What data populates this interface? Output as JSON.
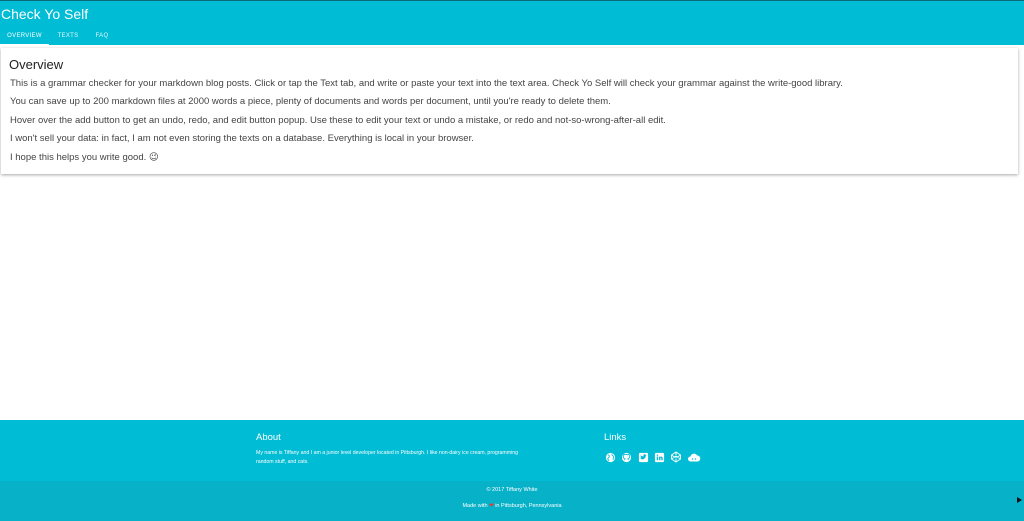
{
  "header": {
    "title": "Check Yo Self",
    "tabs": [
      {
        "label": "Overview"
      },
      {
        "label": "Texts"
      },
      {
        "label": "FAQ"
      }
    ]
  },
  "overview": {
    "title": "Overview",
    "paragraphs": [
      "This is a grammar checker for your markdown blog posts. Click or tap the Text tab, and write or paste your text into the text area. Check Yo Self will check your grammar against the write-good library.",
      "You can save up to 200 markdown files at 2000 words a piece, plenty of documents and words per document, until you're ready to delete them.",
      "Hover over the add button to get an undo, redo, and edit button popup. Use these to edit your text or undo a mistake, or redo and not-so-wrong-after-all edit.",
      "I won't sell your data: in fact, I am not even storing the texts on a database. Everything is local in your browser.",
      "I hope this helps you write good. 😉"
    ]
  },
  "footer": {
    "about_title": "About",
    "about_text": "My name is Tiffany and I am a junior level developer located in Pittsburgh. I like non-dairy ice cream, programming random stuff, and cats.",
    "links_title": "Links",
    "link_icons": [
      "globe-icon",
      "github-icon",
      "twitter-icon",
      "linkedin-icon",
      "codepen-icon",
      "cloud-icon"
    ],
    "copyright": "© 2017 Tiffany White",
    "made_with_prefix": "Made with",
    "heart": "❤",
    "made_with_suffix": "in Pittsburgh, Pennsylvania"
  },
  "colors": {
    "primary": "#00bcd4",
    "footer_bottom": "#07b1c8",
    "heart": "#e53935"
  }
}
